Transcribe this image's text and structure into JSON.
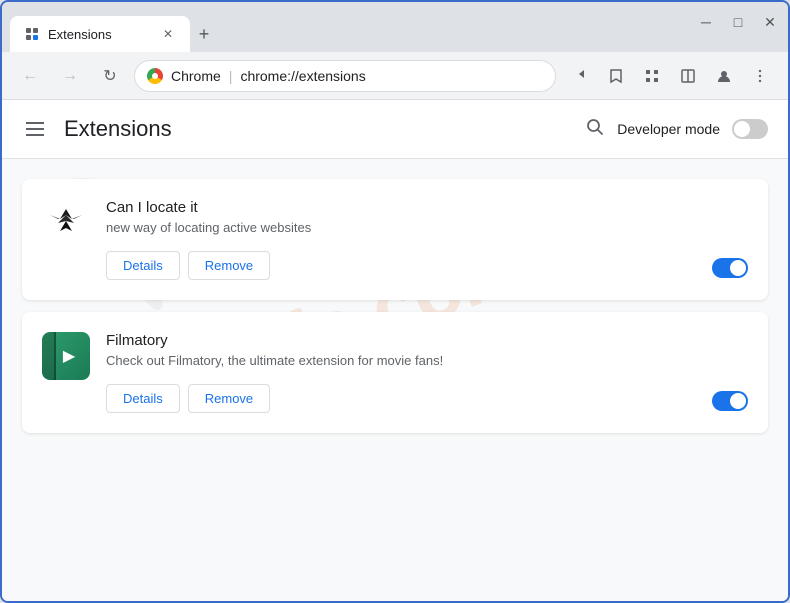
{
  "browser": {
    "tab": {
      "title": "Extensions",
      "favicon": "puzzle-icon"
    },
    "new_tab_label": "+",
    "nav": {
      "back_label": "←",
      "forward_label": "→",
      "reload_label": "↻",
      "address": {
        "site_name": "Chrome",
        "url": "chrome://extensions"
      }
    },
    "window_controls": {
      "minimize": "─",
      "maximize": "□",
      "close": "✕"
    },
    "toolbar_icons": {
      "share": "share-icon",
      "bookmark": "star-icon",
      "extensions": "puzzle-icon",
      "split": "split-icon",
      "profile": "profile-icon",
      "menu": "menu-dots-icon"
    }
  },
  "page": {
    "title": "Extensions",
    "search_label": "🔍",
    "developer_mode": {
      "label": "Developer mode",
      "enabled": false
    },
    "extensions": [
      {
        "id": "can-locate-it",
        "name": "Can I locate it",
        "description": "new way of locating active websites",
        "enabled": true,
        "details_label": "Details",
        "remove_label": "Remove"
      },
      {
        "id": "filmatory",
        "name": "Filmatory",
        "description": "Check out Filmatory, the ultimate extension for movie fans!",
        "enabled": true,
        "details_label": "Details",
        "remove_label": "Remove"
      }
    ]
  }
}
